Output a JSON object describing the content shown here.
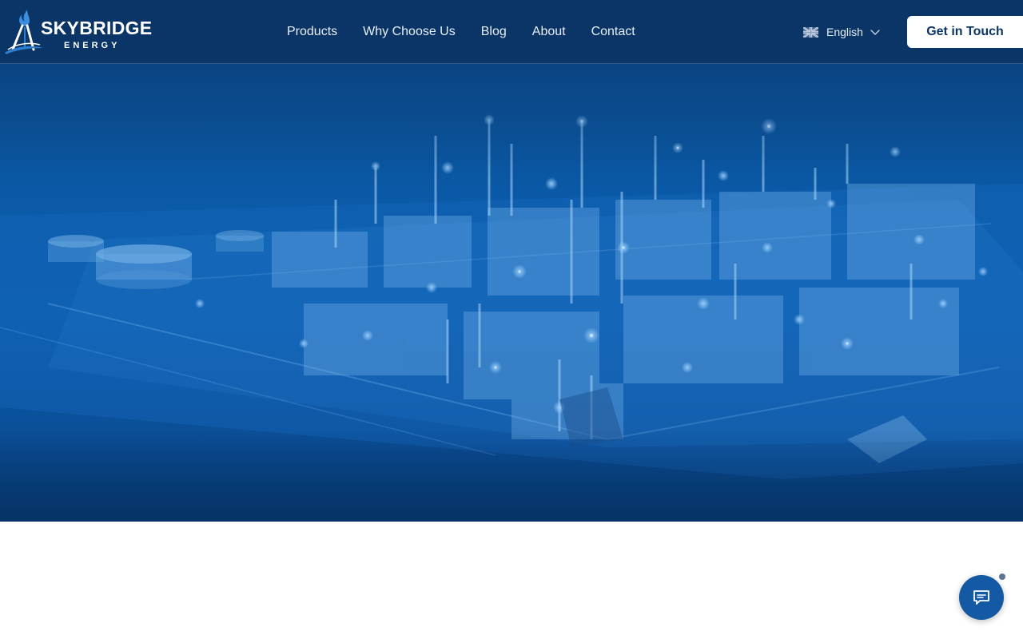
{
  "brand": {
    "name": "SKYBRIDGE",
    "tagline": "ENERGY",
    "colors": {
      "header_bg": "#0a3566",
      "hero_tint": "#0a5cae",
      "cta_text": "#0a3566",
      "chat_bg": "#1459a3"
    }
  },
  "nav": {
    "items": [
      {
        "label": "Products"
      },
      {
        "label": "Why Choose Us"
      },
      {
        "label": "Blog"
      },
      {
        "label": "About"
      },
      {
        "label": "Contact"
      }
    ]
  },
  "language": {
    "selected": "English",
    "flag_icon": "uk-flag-icon",
    "dropdown_icon": "chevron-down-icon"
  },
  "cta": {
    "label": "Get in Touch"
  },
  "hero": {
    "image_subject": "refinery-aerial"
  },
  "chat": {
    "icon": "chat-bubble-icon"
  }
}
